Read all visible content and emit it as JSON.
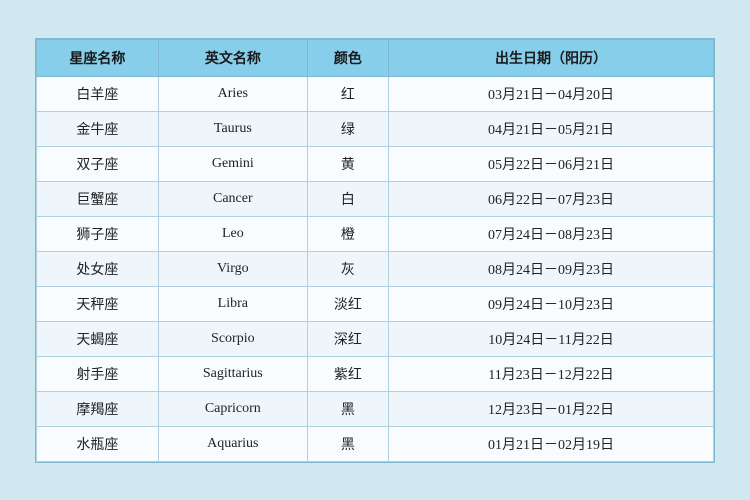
{
  "table": {
    "headers": [
      {
        "id": "col-cn",
        "label": "星座名称"
      },
      {
        "id": "col-en",
        "label": "英文名称"
      },
      {
        "id": "col-color",
        "label": "颜色"
      },
      {
        "id": "col-date",
        "label": "出生日期（阳历）"
      }
    ],
    "rows": [
      {
        "cn": "白羊座",
        "en": "Aries",
        "color": "红",
        "date": "03月21日－04月20日"
      },
      {
        "cn": "金牛座",
        "en": "Taurus",
        "color": "绿",
        "date": "04月21日－05月21日"
      },
      {
        "cn": "双子座",
        "en": "Gemini",
        "color": "黄",
        "date": "05月22日－06月21日"
      },
      {
        "cn": "巨蟹座",
        "en": "Cancer",
        "color": "白",
        "date": "06月22日－07月23日"
      },
      {
        "cn": "狮子座",
        "en": "Leo",
        "color": "橙",
        "date": "07月24日－08月23日"
      },
      {
        "cn": "处女座",
        "en": "Virgo",
        "color": "灰",
        "date": "08月24日－09月23日"
      },
      {
        "cn": "天秤座",
        "en": "Libra",
        "color": "淡红",
        "date": "09月24日－10月23日"
      },
      {
        "cn": "天蝎座",
        "en": "Scorpio",
        "color": "深红",
        "date": "10月24日－11月22日"
      },
      {
        "cn": "射手座",
        "en": "Sagittarius",
        "color": "紫红",
        "date": "11月23日－12月22日"
      },
      {
        "cn": "摩羯座",
        "en": "Capricorn",
        "color": "黑",
        "date": "12月23日－01月22日"
      },
      {
        "cn": "水瓶座",
        "en": "Aquarius",
        "color": "黑",
        "date": "01月21日－02月19日"
      }
    ]
  }
}
